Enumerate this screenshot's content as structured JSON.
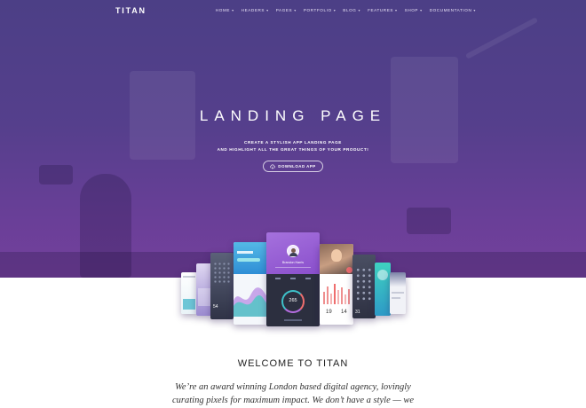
{
  "header": {
    "logo": "TITAN",
    "menu": [
      {
        "label": "HOME",
        "dropdown": true
      },
      {
        "label": "HEADERS",
        "dropdown": true
      },
      {
        "label": "PAGES",
        "dropdown": true
      },
      {
        "label": "PORTFOLIO",
        "dropdown": true
      },
      {
        "label": "BLOG",
        "dropdown": true
      },
      {
        "label": "FEATURES",
        "dropdown": true
      },
      {
        "label": "SHOP",
        "dropdown": true
      },
      {
        "label": "DOCUMENTATION",
        "dropdown": true
      }
    ]
  },
  "hero": {
    "title": "LANDING PAGE",
    "subtitle_line1": "CREATE A STYLISH APP LANDING PAGE",
    "subtitle_line2": "AND HIGHLIGHT ALL THE GREAT THINGS OF YOUR PRODUCT!",
    "cta_label": "DOWNLOAD APP",
    "cta_icon": "cloud-download-icon"
  },
  "mockup": {
    "profile_name": "Brandon Harris",
    "gauge_value": "265",
    "stat_a": "19",
    "stat_b": "14",
    "stat_c": "54",
    "stat_d": "31"
  },
  "welcome": {
    "title": "WELCOME TO TITAN",
    "text_line1": "We’re an award winning London based digital agency, lovingly",
    "text_line2": "curating pixels for maximum impact. We don’t have a style — we"
  },
  "colors": {
    "hero_top": "#4c3f86",
    "hero_bottom": "#74409c",
    "accent_purple": "#9b59d0",
    "accent_teal": "#3ec1c9",
    "accent_coral": "#ef6e6e"
  }
}
